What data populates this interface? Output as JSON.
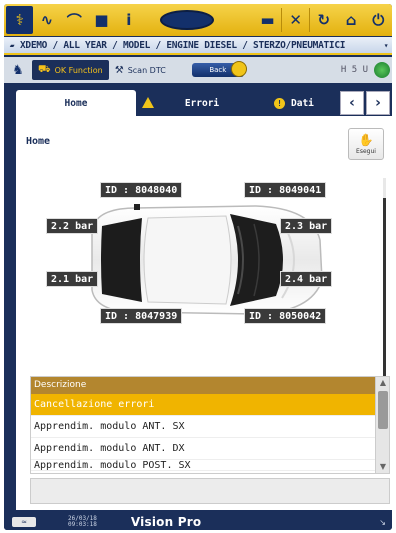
{
  "breadcrumb": "XDEMO / ALL YEAR / MODEL / ENGINE DIESEL / STERZO/PNEUMATICI",
  "funcbar": {
    "ok_function": "OK Function",
    "scan_dtc": "Scan DTC",
    "back": "Back",
    "status": "H 5 U"
  },
  "tabs": {
    "home": "Home",
    "errori": "Errori",
    "dati": "Dati"
  },
  "panel": {
    "title": "Home",
    "esegui": "Esegui"
  },
  "tires": {
    "id_front_left": "ID : 8048040",
    "id_front_right": "ID : 8049041",
    "id_rear_left": "ID : 8047939",
    "id_rear_right": "ID : 8050042",
    "pressure_front_left": "2.2 bar",
    "pressure_front_right": "2.3 bar",
    "pressure_rear_left": "2.1 bar",
    "pressure_rear_right": "2.4 bar"
  },
  "list": {
    "header": "Descrizione",
    "items": [
      "Cancellazione errori",
      "Apprendim. modulo ANT. SX",
      "Apprendim. modulo ANT. DX",
      "Apprendim. modulo POST. SX"
    ]
  },
  "footer": {
    "date": "26/03/18",
    "time": "09:03:18",
    "title": "Vision Pro"
  },
  "colors": {
    "accent": "#f0c419",
    "navy": "#1b2f5a",
    "selected": "#f0b400"
  }
}
